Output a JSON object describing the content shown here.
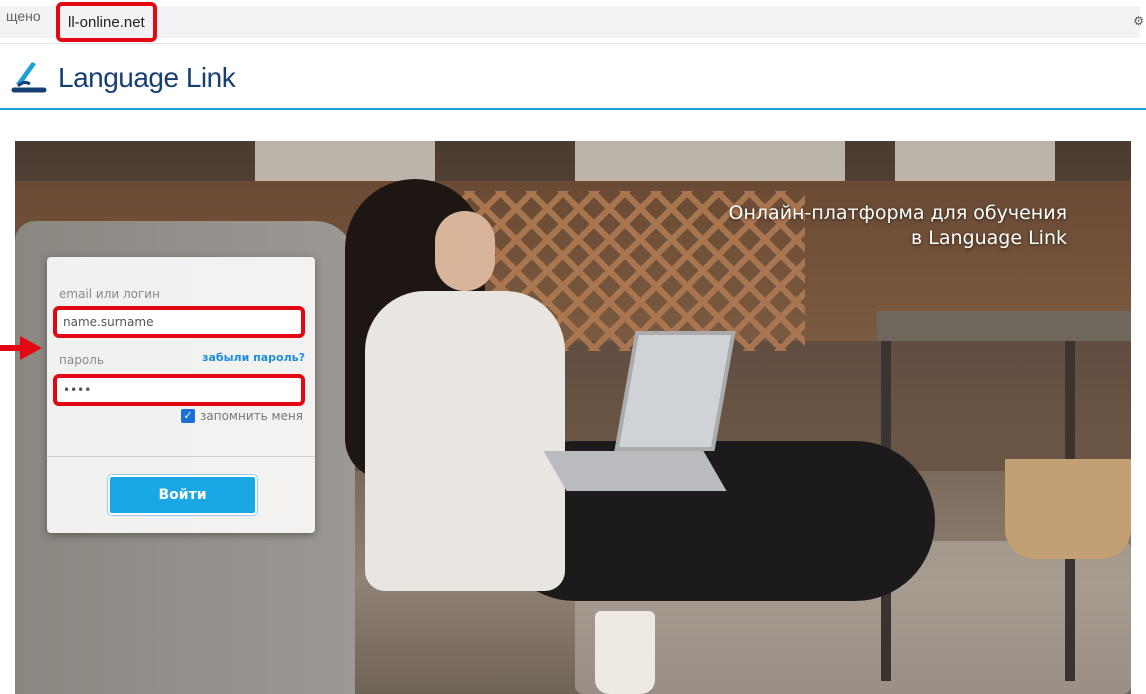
{
  "browser": {
    "address_prefix": "щено",
    "url": "ll-online.net",
    "tail_icon": "settings-icon"
  },
  "header": {
    "logo_text": "Language Link",
    "brand_color": "#163f73",
    "accent_color": "#1ba0d8"
  },
  "hero": {
    "title": "Онлайн-платформа для обучения в Language Link"
  },
  "login": {
    "email_label": "email или логин",
    "email_value": "name.surname",
    "password_label": "пароль",
    "password_value": "••••",
    "forgot_link": "забыли пароль?",
    "remember_label": "запомнить меня",
    "remember_checked": true,
    "submit_label": "Войти",
    "highlight_color": "#e30613"
  }
}
